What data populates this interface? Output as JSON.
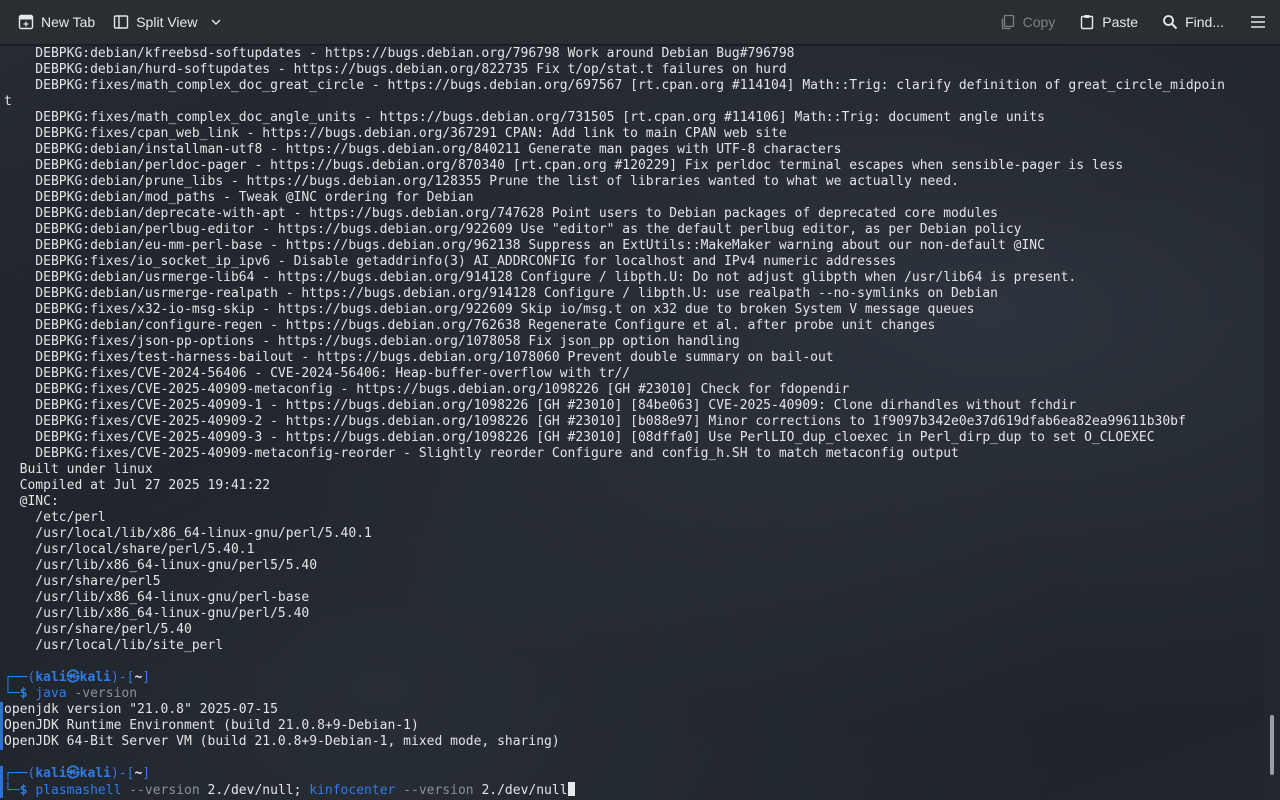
{
  "toolbar": {
    "new_tab": "New Tab",
    "split_view": "Split View",
    "copy": "Copy",
    "paste": "Paste",
    "find": "Find..."
  },
  "icons": {
    "new_tab": "new-tab-icon",
    "split_view": "split-view-icon",
    "dropdown": "chevron-down-icon",
    "copy": "copy-icon",
    "paste": "paste-icon",
    "find": "search-icon",
    "menu": "hamburger-menu-icon"
  },
  "colors": {
    "prompt_accent": "#2f7ce6",
    "toolbar_bg": "#2a2e33",
    "text": "#e2e4e6"
  },
  "terminal": {
    "scroll_position": 0.97,
    "lines": [
      "    DEBPKG:debian/kfreebsd-softupdates - https://bugs.debian.org/796798 Work around Debian Bug#796798",
      "    DEBPKG:debian/hurd-softupdates - https://bugs.debian.org/822735 Fix t/op/stat.t failures on hurd",
      "    DEBPKG:fixes/math_complex_doc_great_circle - https://bugs.debian.org/697567 [rt.cpan.org #114104] Math::Trig: clarify definition of great_circle_midpoin",
      "t",
      "    DEBPKG:fixes/math_complex_doc_angle_units - https://bugs.debian.org/731505 [rt.cpan.org #114106] Math::Trig: document angle units",
      "    DEBPKG:fixes/cpan_web_link - https://bugs.debian.org/367291 CPAN: Add link to main CPAN web site",
      "    DEBPKG:debian/installman-utf8 - https://bugs.debian.org/840211 Generate man pages with UTF-8 characters",
      "    DEBPKG:debian/perldoc-pager - https://bugs.debian.org/870340 [rt.cpan.org #120229] Fix perldoc terminal escapes when sensible-pager is less",
      "    DEBPKG:debian/prune_libs - https://bugs.debian.org/128355 Prune the list of libraries wanted to what we actually need.",
      "    DEBPKG:debian/mod_paths - Tweak @INC ordering for Debian",
      "    DEBPKG:debian/deprecate-with-apt - https://bugs.debian.org/747628 Point users to Debian packages of deprecated core modules",
      "    DEBPKG:debian/perlbug-editor - https://bugs.debian.org/922609 Use \"editor\" as the default perlbug editor, as per Debian policy",
      "    DEBPKG:debian/eu-mm-perl-base - https://bugs.debian.org/962138 Suppress an ExtUtils::MakeMaker warning about our non-default @INC",
      "    DEBPKG:fixes/io_socket_ip_ipv6 - Disable getaddrinfo(3) AI_ADDRCONFIG for localhost and IPv4 numeric addresses",
      "    DEBPKG:debian/usrmerge-lib64 - https://bugs.debian.org/914128 Configure / libpth.U: Do not adjust glibpth when /usr/lib64 is present.",
      "    DEBPKG:debian/usrmerge-realpath - https://bugs.debian.org/914128 Configure / libpth.U: use realpath --no-symlinks on Debian",
      "    DEBPKG:fixes/x32-io-msg-skip - https://bugs.debian.org/922609 Skip io/msg.t on x32 due to broken System V message queues",
      "    DEBPKG:debian/configure-regen - https://bugs.debian.org/762638 Regenerate Configure et al. after probe unit changes",
      "    DEBPKG:fixes/json-pp-options - https://bugs.debian.org/1078058 Fix json_pp option handling",
      "    DEBPKG:fixes/test-harness-bailout - https://bugs.debian.org/1078060 Prevent double summary on bail-out",
      "    DEBPKG:fixes/CVE-2024-56406 - CVE-2024-56406: Heap-buffer-overflow with tr//",
      "    DEBPKG:fixes/CVE-2025-40909-metaconfig - https://bugs.debian.org/1098226 [GH #23010] Check for fdopendir",
      "    DEBPKG:fixes/CVE-2025-40909-1 - https://bugs.debian.org/1098226 [GH #23010] [84be063] CVE-2025-40909: Clone dirhandles without fchdir",
      "    DEBPKG:fixes/CVE-2025-40909-2 - https://bugs.debian.org/1098226 [GH #23010] [b088e97] Minor corrections to 1f9097b342e0e37d619dfab6ea82ea99611b30bf",
      "    DEBPKG:fixes/CVE-2025-40909-3 - https://bugs.debian.org/1098226 [GH #23010] [08dffa0] Use PerlLIO_dup_cloexec in Perl_dirp_dup to set O_CLOEXEC",
      "    DEBPKG:fixes/CVE-2025-40909-metaconfig-reorder - Slightly reorder Configure and config_h.SH to match metaconfig output",
      "  Built under linux",
      "  Compiled at Jul 27 2025 19:41:22",
      "  @INC:",
      "    /etc/perl",
      "    /usr/local/lib/x86_64-linux-gnu/perl/5.40.1",
      "    /usr/local/share/perl/5.40.1",
      "    /usr/lib/x86_64-linux-gnu/perl5/5.40",
      "    /usr/share/perl5",
      "    /usr/lib/x86_64-linux-gnu/perl-base",
      "    /usr/lib/x86_64-linux-gnu/perl/5.40",
      "    /usr/share/perl/5.40",
      "    /usr/local/lib/site_perl"
    ],
    "prompt": {
      "frame_top": "┌──(",
      "user": "kali",
      "at": "㉿",
      "host": "kali",
      "mid": ")-[",
      "dir": "~",
      "close": "]",
      "frame_bottom": "└─",
      "dollar": "$"
    },
    "command1": {
      "name": "java",
      "args": " -version"
    },
    "output1": [
      "openjdk version \"21.0.8\" 2025-07-15",
      "OpenJDK Runtime Environment (build 21.0.8+9-Debian-1)",
      "OpenJDK 64-Bit Server VM (build 21.0.8+9-Debian-1, mixed mode, sharing)"
    ],
    "command2": {
      "name1": "plasmashell",
      "args1": " --version ",
      "redirect1": "2./dev/null",
      "sep": "; ",
      "name2": "kinfocenter",
      "args2": " --version ",
      "redirect2": "2./dev/null"
    }
  }
}
